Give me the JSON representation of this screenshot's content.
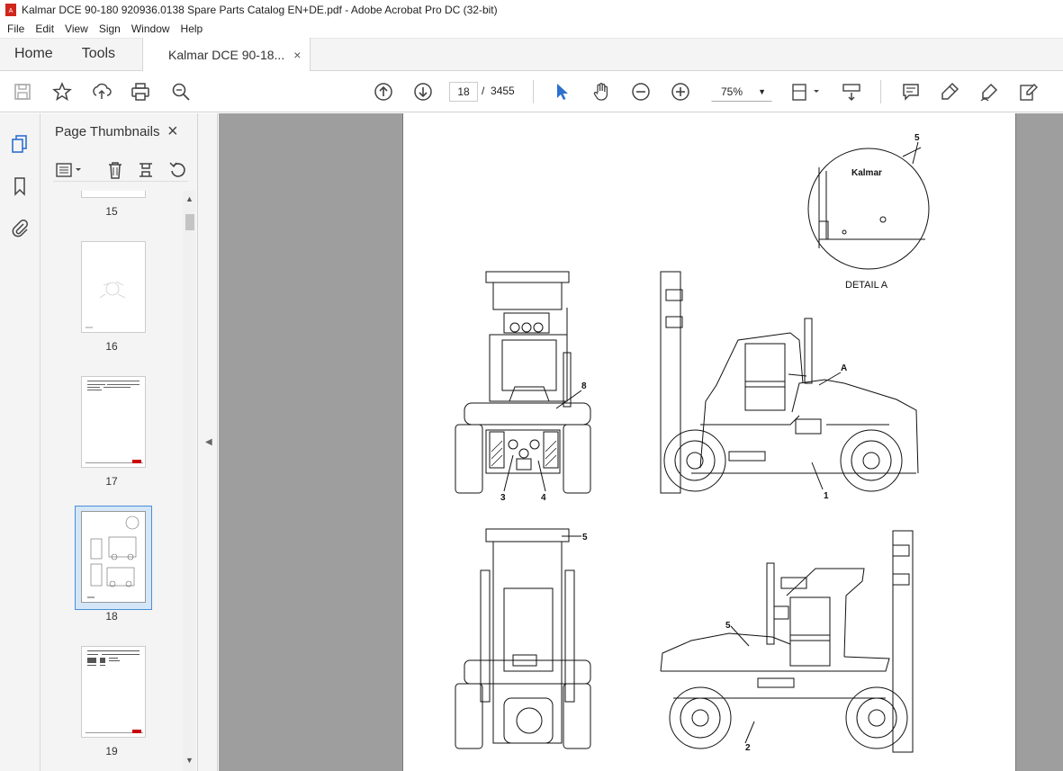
{
  "window": {
    "title": "Kalmar DCE 90-180 920936.0138 Spare Parts Catalog EN+DE.pdf - Adobe Acrobat Pro DC (32-bit)"
  },
  "menu": [
    "File",
    "Edit",
    "View",
    "Sign",
    "Window",
    "Help"
  ],
  "tabs": {
    "home": "Home",
    "tools": "Tools",
    "document": "Kalmar DCE 90-18...",
    "document_close": "×"
  },
  "toolbar": {
    "icons": [
      "save-icon",
      "star-icon",
      "share-icon",
      "print-icon",
      "zoom-search-icon",
      "prev-page-icon",
      "next-page-icon",
      "select-arrow-icon",
      "hand-icon",
      "zoom-out-icon",
      "zoom-in-icon",
      "fit-page-icon",
      "scroll-mode-icon",
      "comment-icon",
      "highlight-icon",
      "sign-icon",
      "edit-pdf-icon"
    ],
    "current_page": "18",
    "page_separator": "/",
    "total_pages": "3455",
    "zoom": "75%"
  },
  "sidebar": {
    "title": "Page Thumbnails",
    "close": "×",
    "thumbnails": [
      {
        "label": "15"
      },
      {
        "label": "16"
      },
      {
        "label": "17"
      },
      {
        "label": "18",
        "selected": true
      },
      {
        "label": "19"
      }
    ]
  },
  "document_page": {
    "detail_label": "DETAIL A",
    "brand_mark": "Kalmar",
    "callouts": [
      "5",
      "A",
      "8",
      "3",
      "4",
      "1",
      "5",
      "5",
      "2"
    ]
  },
  "colors": {
    "accent": "#2e6fcf",
    "page_bg": "#9e9e9e",
    "selected_thumb": "#d4e6f8"
  }
}
